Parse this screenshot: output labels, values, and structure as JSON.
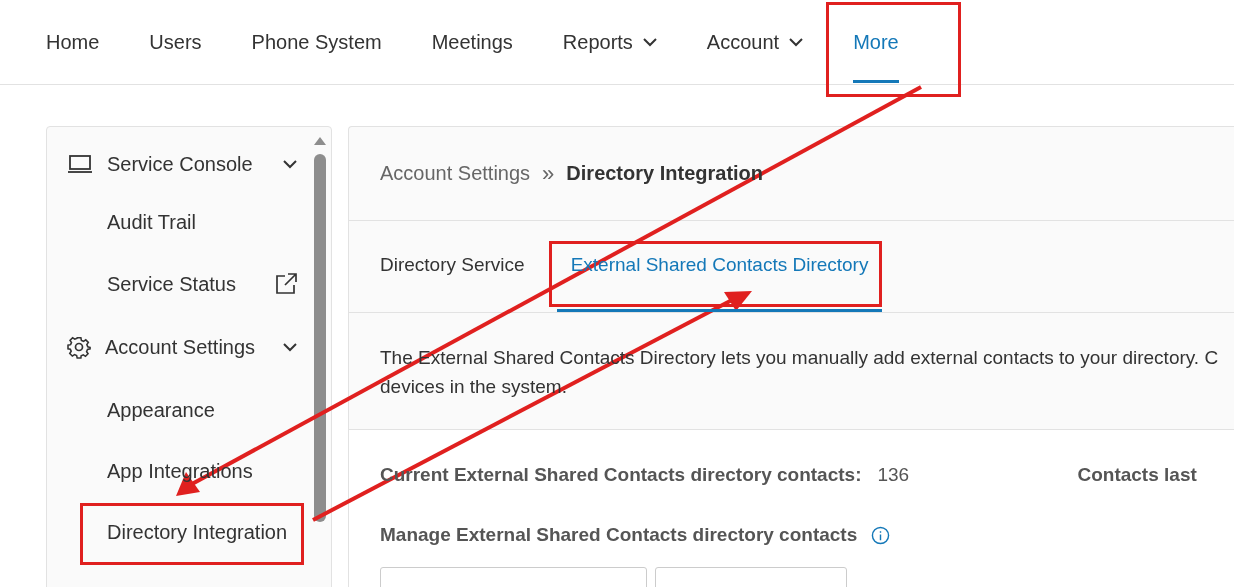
{
  "nav": [
    {
      "label": "Home",
      "selected": false,
      "dropdown": false,
      "highlighted": false
    },
    {
      "label": "Users",
      "selected": false,
      "dropdown": false,
      "highlighted": false
    },
    {
      "label": "Phone System",
      "selected": false,
      "dropdown": false,
      "highlighted": false
    },
    {
      "label": "Meetings",
      "selected": false,
      "dropdown": false,
      "highlighted": false
    },
    {
      "label": "Reports",
      "selected": false,
      "dropdown": true,
      "highlighted": false
    },
    {
      "label": "Account",
      "selected": false,
      "dropdown": true,
      "highlighted": false
    },
    {
      "label": "More",
      "selected": true,
      "dropdown": false,
      "highlighted": true
    }
  ],
  "sidebar": {
    "items": [
      {
        "label": "Service Console",
        "kind": "console",
        "expanded": true,
        "highlighted": false
      },
      {
        "label": "Audit Trail",
        "kind": "link",
        "highlighted": false
      },
      {
        "label": "Service Status",
        "kind": "external",
        "highlighted": false
      },
      {
        "label": "Account Settings",
        "kind": "settings",
        "expanded": true,
        "highlighted": false
      },
      {
        "label": "Appearance",
        "kind": "link",
        "highlighted": false
      },
      {
        "label": "App Integrations",
        "kind": "link",
        "highlighted": false
      },
      {
        "label": "Directory Integration",
        "kind": "link",
        "highlighted": true
      }
    ]
  },
  "breadcrumb": {
    "parent": "Account Settings",
    "separator": "»",
    "current": "Directory Integration"
  },
  "tabs": [
    {
      "label": "Directory Service",
      "selected": false,
      "highlighted": false
    },
    {
      "label": "External Shared Contacts Directory",
      "selected": true,
      "highlighted": true
    }
  ],
  "description": "The External Shared Contacts Directory lets you manually add external contacts to your directory. C",
  "description_line2": "devices in the system.",
  "stats": {
    "label": "Current External Shared Contacts directory contacts:",
    "value": "136",
    "label_2": "Contacts last"
  },
  "manage": {
    "label": "Manage External Shared Contacts directory contacts"
  }
}
